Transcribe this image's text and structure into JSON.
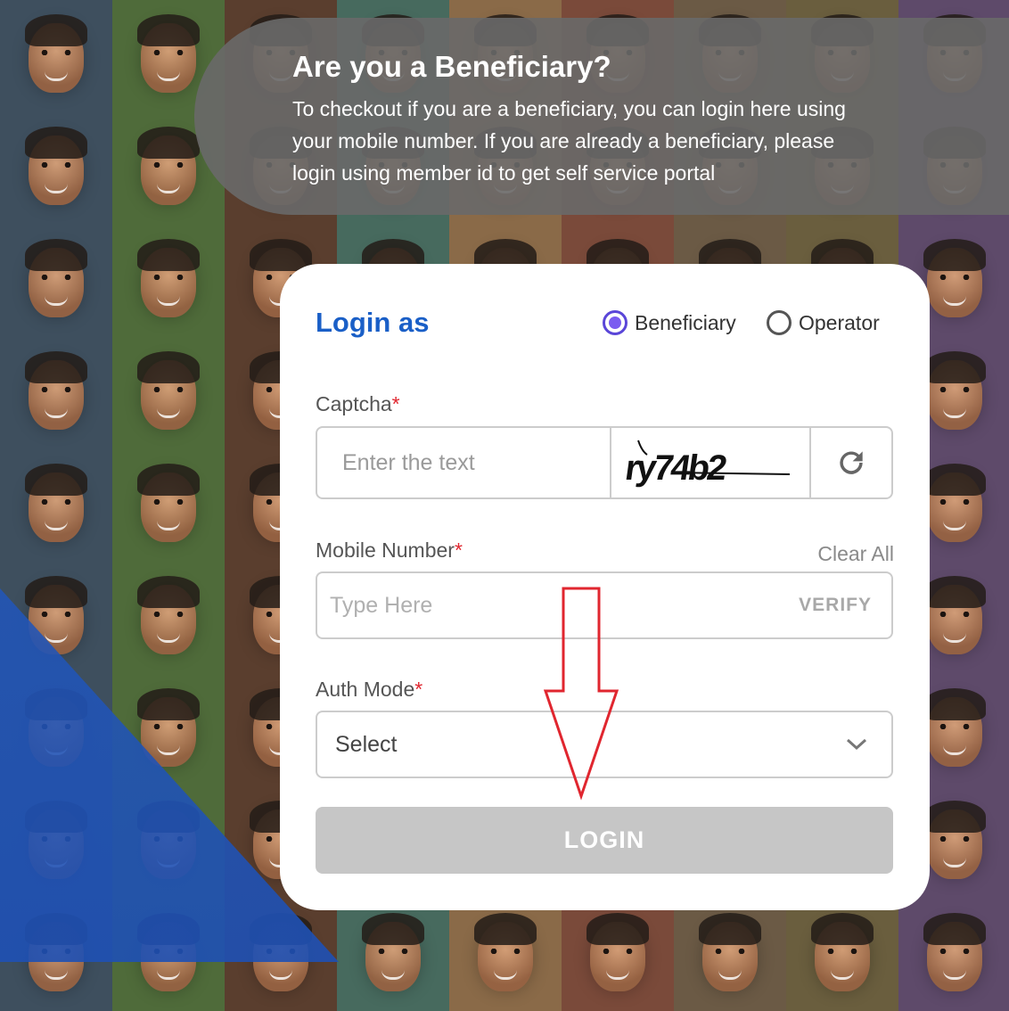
{
  "banner": {
    "title": "Are you a Beneficiary?",
    "description": "To checkout if you are a beneficiary, you can login here using your mobile number. If you are already a beneficiary, please login using member id to get self service portal"
  },
  "login": {
    "heading": "Login as",
    "roles": [
      {
        "label": "Beneficiary",
        "selected": true
      },
      {
        "label": "Operator",
        "selected": false
      }
    ],
    "captcha": {
      "label": "Captcha",
      "required_mark": "*",
      "placeholder": "Enter the text",
      "image_text": "ry74b2",
      "refresh_icon": "refresh-icon"
    },
    "mobile": {
      "label": "Mobile Number",
      "required_mark": "*",
      "placeholder": "Type Here",
      "verify_label": "VERIFY",
      "clear_label": "Clear All"
    },
    "auth_mode": {
      "label": "Auth Mode",
      "required_mark": "*",
      "selected": "Select",
      "chevron_icon": "chevron-down-icon"
    },
    "submit_label": "LOGIN"
  },
  "colors": {
    "accent": "#1a5fc7",
    "radio_selected": "#7a5cf0",
    "required": "#e0262f",
    "button_disabled": "#c6c6c6",
    "annotation_arrow": "#e0262f"
  },
  "annotation": {
    "arrow_direction": "down",
    "points_to": "login-button"
  }
}
